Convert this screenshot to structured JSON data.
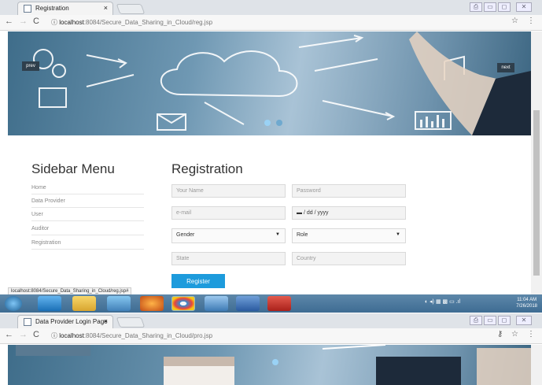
{
  "window1": {
    "tab_title": "Registration",
    "tab_close": "×",
    "url_host": "localhost",
    "url_path": ":8084/Secure_Data_Sharing_in_Cloud/reg.jsp",
    "info_icon": "ⓘ",
    "bookmark_icon": "☆",
    "menu_icon": "⋮",
    "window_controls": [
      "⎙",
      "▭",
      "◻",
      "✕"
    ]
  },
  "slider": {
    "prev_label": "prev",
    "next_label": "next"
  },
  "sidebar": {
    "title": "Sidebar Menu",
    "items": [
      {
        "label": "Home"
      },
      {
        "label": "Data Provider"
      },
      {
        "label": "User"
      },
      {
        "label": "Auditor"
      },
      {
        "label": "Registration"
      }
    ]
  },
  "form": {
    "title": "Registration",
    "name_placeholder": "Your Name",
    "password_placeholder": "Password",
    "email_placeholder": "e-mail",
    "date_placeholder": "▬ / dd / yyyy",
    "gender_value": "Gender",
    "role_value": "Role",
    "state_placeholder": "State",
    "country_placeholder": "Country",
    "register_label": "Register"
  },
  "status_url": "localhost:8084/Secure_Data_Sharing_in_Cloud/reg.jsp#",
  "taskbar": {
    "time": "11:04 AM",
    "date": "7/26/2018",
    "tray_icons": "◐ ◂) ▦ ▩ ▭ .ıl"
  },
  "window2": {
    "tab_title": "Data Provider Login Page",
    "tab_close": "×",
    "url_host": "localhost",
    "url_path": ":8084/Secure_Data_Sharing_in_Cloud/pro.jsp",
    "info_icon": "ⓘ",
    "key_icon": "⚷",
    "bookmark_icon": "☆",
    "menu_icon": "⋮",
    "window_controls": [
      "⎙",
      "▭",
      "◻",
      "✕"
    ]
  },
  "colors": {
    "accent": "#1d9bdc",
    "taskbar": "#4a769b"
  }
}
